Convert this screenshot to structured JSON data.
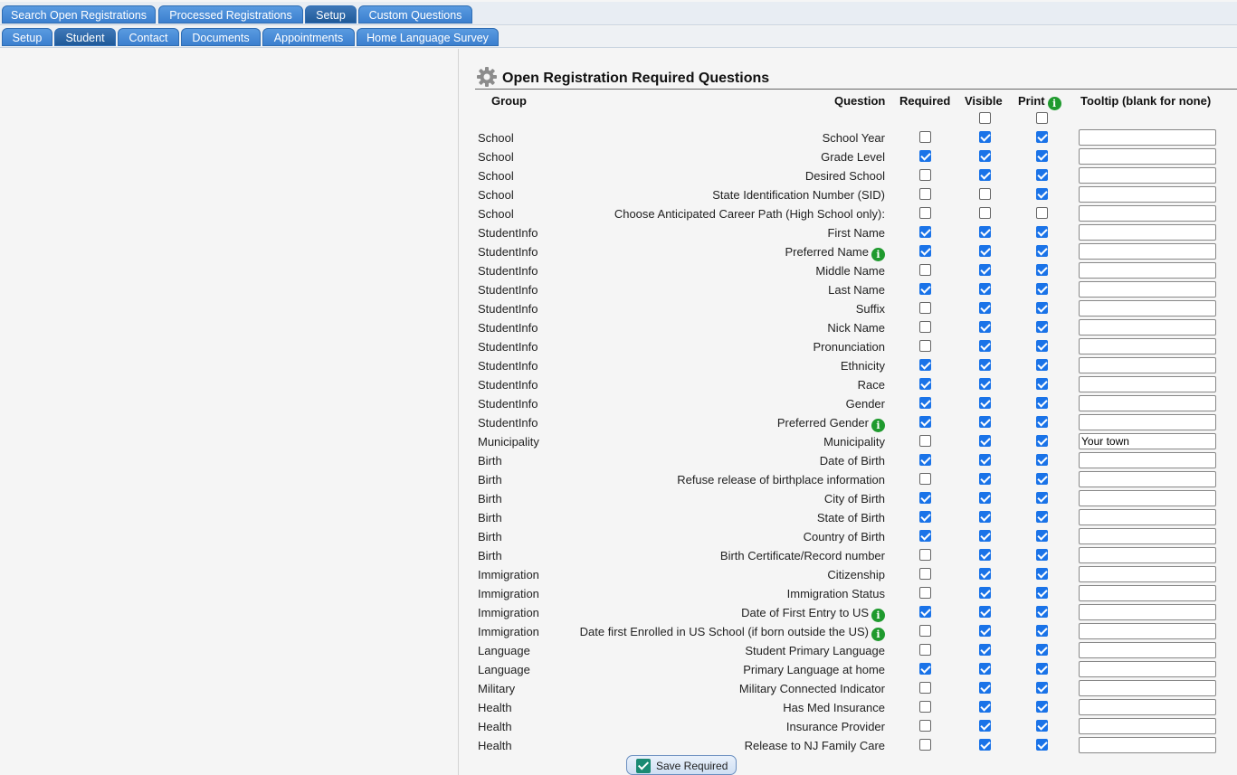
{
  "tabs_top": [
    {
      "label": "Search Open Registrations",
      "active": false
    },
    {
      "label": "Processed Registrations",
      "active": false
    },
    {
      "label": "Setup",
      "active": true
    },
    {
      "label": "Custom Questions",
      "active": false
    }
  ],
  "tabs_sub": [
    {
      "label": "Setup",
      "active": false
    },
    {
      "label": "Student",
      "active": true
    },
    {
      "label": "Contact",
      "active": false
    },
    {
      "label": "Documents",
      "active": false
    },
    {
      "label": "Appointments",
      "active": false
    },
    {
      "label": "Home Language Survey",
      "active": false
    }
  ],
  "panel": {
    "title": "Open Registration Required Questions",
    "icon": "gear-icon",
    "headers": {
      "group": "Group",
      "question": "Question",
      "required": "Required",
      "visible": "Visible",
      "print": "Print",
      "tooltip": "Tooltip (blank for none)"
    },
    "select_all": {
      "visible": false,
      "print": false
    }
  },
  "rows": [
    {
      "group": "School",
      "question": "School Year",
      "info": false,
      "required": false,
      "visible": true,
      "print": true,
      "tooltip": ""
    },
    {
      "group": "School",
      "question": "Grade Level",
      "info": false,
      "required": true,
      "visible": true,
      "print": true,
      "tooltip": ""
    },
    {
      "group": "School",
      "question": "Desired School",
      "info": false,
      "required": false,
      "visible": true,
      "print": true,
      "tooltip": ""
    },
    {
      "group": "School",
      "question": "State Identification Number (SID)",
      "info": false,
      "required": false,
      "visible": false,
      "print": true,
      "tooltip": ""
    },
    {
      "group": "School",
      "question": "Choose Anticipated Career Path (High School only):",
      "info": false,
      "required": false,
      "visible": false,
      "print": false,
      "tooltip": ""
    },
    {
      "group": "StudentInfo",
      "question": "First Name",
      "info": false,
      "required": true,
      "visible": true,
      "print": true,
      "tooltip": ""
    },
    {
      "group": "StudentInfo",
      "question": "Preferred Name",
      "info": true,
      "required": true,
      "visible": true,
      "print": true,
      "tooltip": ""
    },
    {
      "group": "StudentInfo",
      "question": "Middle Name",
      "info": false,
      "required": false,
      "visible": true,
      "print": true,
      "tooltip": ""
    },
    {
      "group": "StudentInfo",
      "question": "Last Name",
      "info": false,
      "required": true,
      "visible": true,
      "print": true,
      "tooltip": ""
    },
    {
      "group": "StudentInfo",
      "question": "Suffix",
      "info": false,
      "required": false,
      "visible": true,
      "print": true,
      "tooltip": ""
    },
    {
      "group": "StudentInfo",
      "question": "Nick Name",
      "info": false,
      "required": false,
      "visible": true,
      "print": true,
      "tooltip": ""
    },
    {
      "group": "StudentInfo",
      "question": "Pronunciation",
      "info": false,
      "required": false,
      "visible": true,
      "print": true,
      "tooltip": ""
    },
    {
      "group": "StudentInfo",
      "question": "Ethnicity",
      "info": false,
      "required": true,
      "visible": true,
      "print": true,
      "tooltip": ""
    },
    {
      "group": "StudentInfo",
      "question": "Race",
      "info": false,
      "required": true,
      "visible": true,
      "print": true,
      "tooltip": ""
    },
    {
      "group": "StudentInfo",
      "question": "Gender",
      "info": false,
      "required": true,
      "visible": true,
      "print": true,
      "tooltip": ""
    },
    {
      "group": "StudentInfo",
      "question": "Preferred Gender",
      "info": true,
      "required": true,
      "visible": true,
      "print": true,
      "tooltip": ""
    },
    {
      "group": "Municipality",
      "question": "Municipality",
      "info": false,
      "required": false,
      "visible": true,
      "print": true,
      "tooltip": "Your town"
    },
    {
      "group": "Birth",
      "question": "Date of Birth",
      "info": false,
      "required": true,
      "visible": true,
      "print": true,
      "tooltip": ""
    },
    {
      "group": "Birth",
      "question": "Refuse release of birthplace information",
      "info": false,
      "required": false,
      "visible": true,
      "print": true,
      "tooltip": ""
    },
    {
      "group": "Birth",
      "question": "City of Birth",
      "info": false,
      "required": true,
      "visible": true,
      "print": true,
      "tooltip": ""
    },
    {
      "group": "Birth",
      "question": "State of Birth",
      "info": false,
      "required": true,
      "visible": true,
      "print": true,
      "tooltip": ""
    },
    {
      "group": "Birth",
      "question": "Country of Birth",
      "info": false,
      "required": true,
      "visible": true,
      "print": true,
      "tooltip": ""
    },
    {
      "group": "Birth",
      "question": "Birth Certificate/Record number",
      "info": false,
      "required": false,
      "visible": true,
      "print": true,
      "tooltip": ""
    },
    {
      "group": "Immigration",
      "question": "Citizenship",
      "info": false,
      "required": false,
      "visible": true,
      "print": true,
      "tooltip": ""
    },
    {
      "group": "Immigration",
      "question": "Immigration Status",
      "info": false,
      "required": false,
      "visible": true,
      "print": true,
      "tooltip": ""
    },
    {
      "group": "Immigration",
      "question": "Date of First Entry to US",
      "info": true,
      "required": true,
      "visible": true,
      "print": true,
      "tooltip": ""
    },
    {
      "group": "Immigration",
      "question": "Date first Enrolled in US School (if born outside the US)",
      "info": true,
      "required": false,
      "visible": true,
      "print": true,
      "tooltip": ""
    },
    {
      "group": "Language",
      "question": "Student Primary Language",
      "info": false,
      "required": false,
      "visible": true,
      "print": true,
      "tooltip": ""
    },
    {
      "group": "Language",
      "question": "Primary Language at home",
      "info": false,
      "required": true,
      "visible": true,
      "print": true,
      "tooltip": ""
    },
    {
      "group": "Military",
      "question": "Military Connected Indicator",
      "info": false,
      "required": false,
      "visible": true,
      "print": true,
      "tooltip": ""
    },
    {
      "group": "Health",
      "question": "Has Med Insurance",
      "info": false,
      "required": false,
      "visible": true,
      "print": true,
      "tooltip": ""
    },
    {
      "group": "Health",
      "question": "Insurance Provider",
      "info": false,
      "required": false,
      "visible": true,
      "print": true,
      "tooltip": ""
    },
    {
      "group": "Health",
      "question": "Release to NJ Family Care",
      "info": false,
      "required": false,
      "visible": true,
      "print": true,
      "tooltip": ""
    }
  ],
  "save_button": {
    "label": "Save Required",
    "icon": "check-icon"
  },
  "info_icon": {
    "glyph": "i",
    "color": "#1f9a2e"
  },
  "colors": {
    "tab": "#3b7fcf",
    "tab_active": "#1f5a99",
    "checkbox": "#1a73e8"
  }
}
